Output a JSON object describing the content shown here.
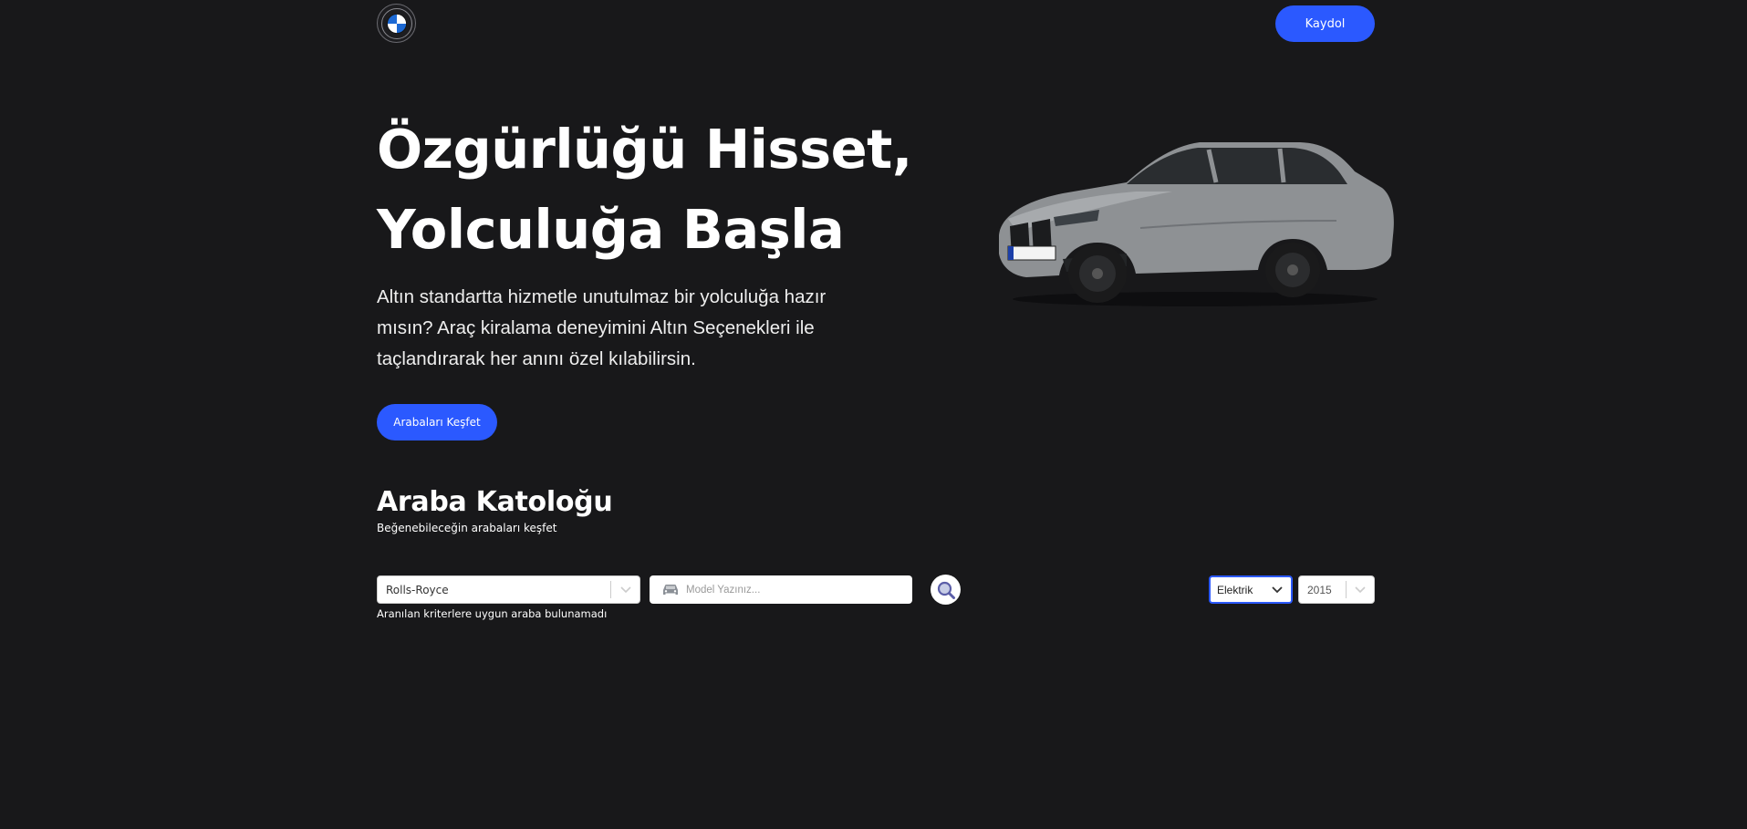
{
  "header": {
    "logo_icon": "bmw-logo-icon",
    "signup_label": "Kaydol"
  },
  "hero": {
    "title_line1": "Özgürlüğü Hisset,",
    "title_line2": "Yolculuğa Başla",
    "description": "Altın standartta hizmetle unutulmaz bir yolculuğa hazır mısın? Araç kiralama deneyimini Altın Seçenekleri ile taçlandırarak her anını özel kılabilirsin.",
    "cta_label": "Arabaları Keşfet",
    "image_icon": "car-image"
  },
  "catalog": {
    "title": "Araba Katoloğu",
    "subtitle": "Beğenebileceğin arabaları keşfet",
    "filters": {
      "manufacturer": "Rolls-Royce",
      "model_placeholder": "Model Yazınız...",
      "model_value": "",
      "fuel": "Elektrik",
      "year": "2015"
    },
    "empty_message": "Aranılan kriterlere uygun araba bulunamadı"
  },
  "colors": {
    "background": "#18181a",
    "accent": "#2b59ff",
    "text": "#ffffff"
  }
}
